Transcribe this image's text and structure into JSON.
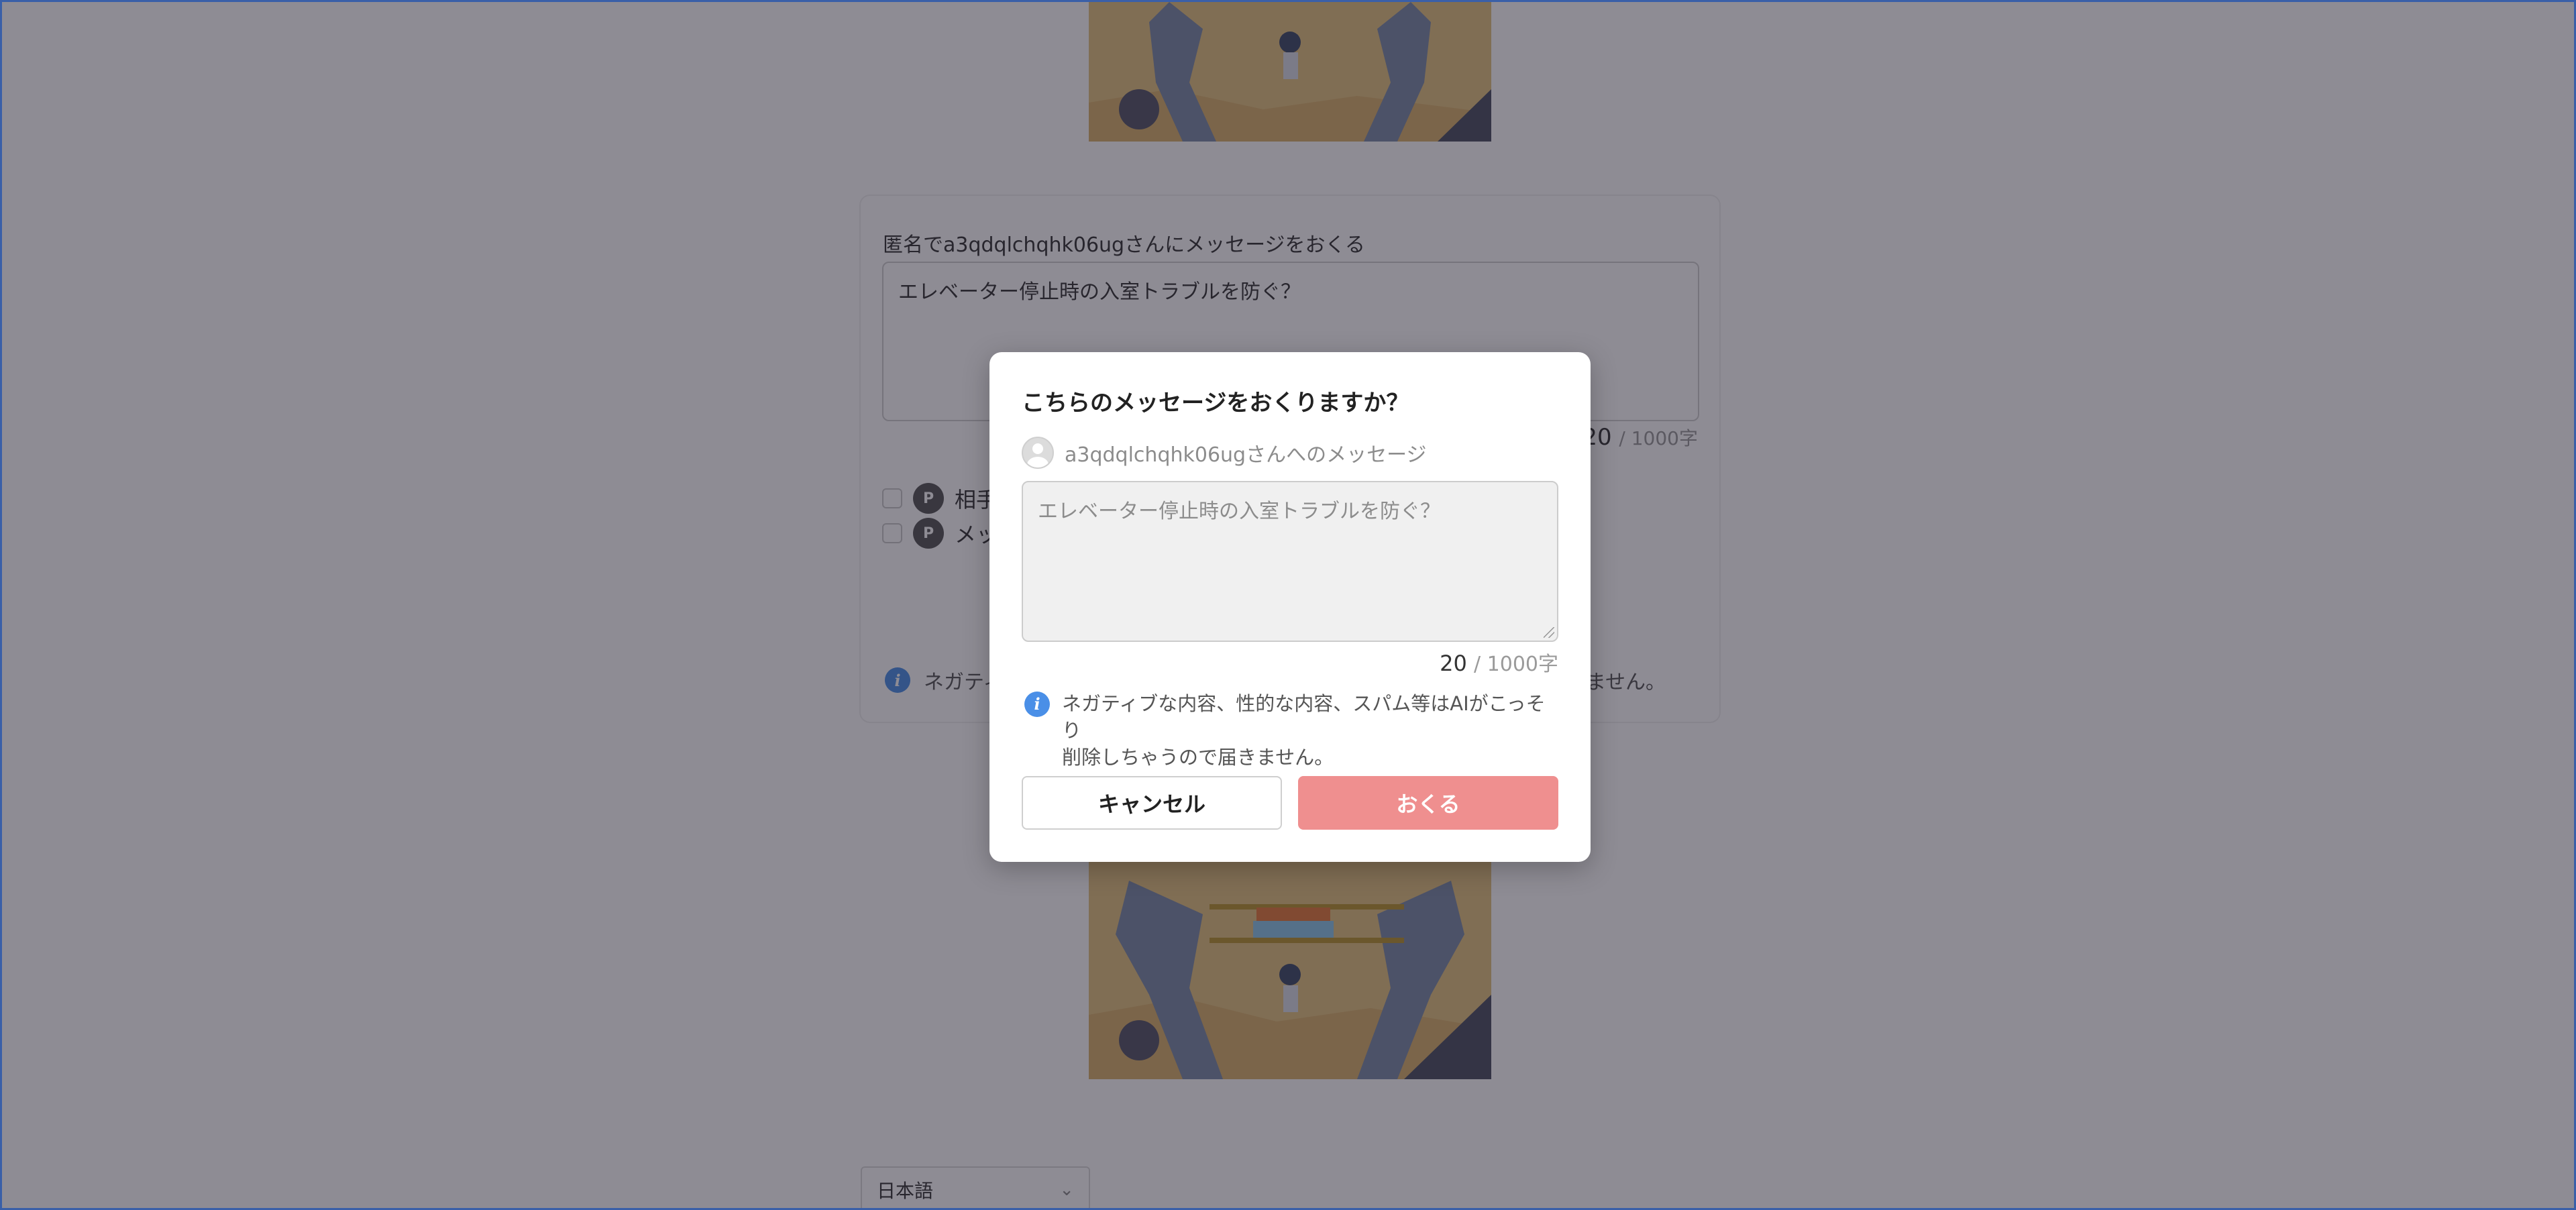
{
  "background": {
    "form": {
      "label": "匿名でa3qdqlchqhk06ugさんにメッセージをおくる",
      "textarea_value": "エレベーター停止時の入室トラブルを防ぐ？",
      "counter_value": "20",
      "counter_max": "/ 1000字",
      "option1_label": "相手",
      "option2_label": "メッ",
      "notice_start": "ネガティ",
      "notice_end": "ません。"
    },
    "language_select": {
      "value": "日本語"
    }
  },
  "modal": {
    "title": "こちらのメッセージをおくりますか？",
    "recipient": "a3qdqlchqhk06ugさんへのメッセージ",
    "message": "エレベーター停止時の入室トラブルを防ぐ？",
    "counter_value": "20",
    "counter_max": "/ 1000字",
    "notice_line1": "ネガティブな内容、性的な内容、スパム等はAIがこっそり",
    "notice_line2": "削除しちゃうので届きません。",
    "cancel_label": "キャンセル",
    "send_label": "おくる"
  },
  "colors": {
    "overlay": "#1e1a2a",
    "send_button": "#ef8f8f",
    "info_icon": "#4a8fe7"
  },
  "icons": {
    "info": "info-icon",
    "avatar": "avatar-icon",
    "chevron": "chevron-down-icon"
  }
}
